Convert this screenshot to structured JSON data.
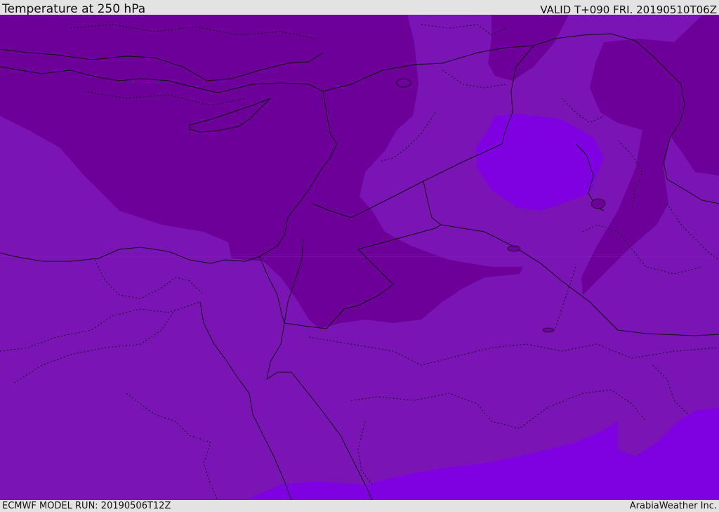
{
  "header": {
    "title": "Temperature at 250 hPa",
    "valid_time": "VALID T+090 FRI. 20190510T06Z"
  },
  "footer": {
    "model_run": "ECMWF MODEL RUN: 20190506T12Z",
    "credit": "ArabiaWeather Inc."
  },
  "colors": {
    "dark_band": "#6c0099",
    "mid_band": "#7a14b5",
    "bright_band": "#7f00e0",
    "border_line": "#111111"
  }
}
